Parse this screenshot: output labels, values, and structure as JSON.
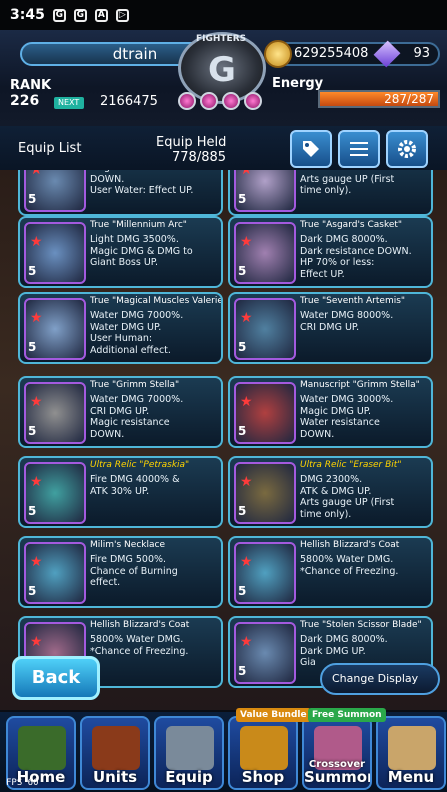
{
  "status_bar": {
    "time": "3:45",
    "icons": [
      "G",
      "G",
      "A",
      "▷"
    ]
  },
  "header": {
    "player_name": "dtrain",
    "coins": "629255408",
    "gems": "93",
    "logo_text": "FIGHTERS",
    "logo_letter": "G",
    "rank_label": "RANK",
    "rank_value": "226",
    "next_label": "NEXT",
    "exp_value": "2166475",
    "energy_label": "Energy",
    "energy_value": "287/287",
    "energy_fraction": 1.0
  },
  "subbar": {
    "equip_list_label": "Equip List",
    "equip_held_label": "Equip Held",
    "equip_held_value": "778/885"
  },
  "cards": [
    {
      "title": "",
      "relic": false,
      "desc": "Magic resistance\nDOWN.\nUser Water: Effect UP.",
      "level": "5"
    },
    {
      "title": "",
      "relic": false,
      "desc": "Dark DMG UP.\nArts gauge UP (First\ntime only).",
      "level": "5"
    },
    {
      "title": "True \"Millennium Arc\"",
      "relic": false,
      "desc": "Light DMG 3500%.\nMagic DMG & DMG to\nGiant Boss UP.",
      "level": "5"
    },
    {
      "title": "True \"Asgard's Casket\"",
      "relic": false,
      "desc": "Dark DMG 8000%.\nDark resistance DOWN.\nHP 70% or less:\nEffect UP.",
      "level": "5"
    },
    {
      "title": "True \"Magical Muscles Valerie\"",
      "relic": false,
      "desc": "Water DMG 7000%.\nWater DMG UP.\nUser Human:\nAdditional effect.",
      "level": "5"
    },
    {
      "title": "True \"Seventh Artemis\"",
      "relic": false,
      "desc": "Water DMG 8000%.\nCRI DMG UP.",
      "level": "5"
    },
    {
      "title": "True \"Grimm Stella\"",
      "relic": false,
      "desc": "Water DMG 7000%.\nCRI DMG UP.\nMagic resistance\nDOWN.",
      "level": "5"
    },
    {
      "title": "Manuscript \"Grimm Stella\"",
      "relic": false,
      "desc": "Water DMG 3000%.\nMagic DMG UP.\nWater resistance\nDOWN.",
      "level": "5"
    },
    {
      "title": "Ultra Relic \"Petraskia\"",
      "relic": true,
      "desc": "Fire DMG 4000% &\nATK 30% UP.",
      "level": "5"
    },
    {
      "title": "Ultra Relic \"Eraser Bit\"",
      "relic": true,
      "desc": "DMG 2300%.\nATK & DMG UP.\nArts gauge UP (First\ntime only).",
      "level": "5"
    },
    {
      "title": "Milim's Necklace",
      "relic": false,
      "desc": "Fire DMG 500%.\nChance of Burning\neffect.",
      "level": "5"
    },
    {
      "title": "Hellish Blizzard's Coat",
      "relic": false,
      "desc": "5800% Water DMG.\n*Chance of Freezing.",
      "level": "5"
    },
    {
      "title": "Hellish Blizzard's Coat",
      "relic": false,
      "desc": "5800% Water DMG.\n*Chance of Freezing.",
      "level": "5"
    },
    {
      "title": "True \"Stolen Scissor Blade\"",
      "relic": false,
      "desc": "Dark DMG 8000%.\nDark DMG UP.\nGia",
      "level": "5"
    }
  ],
  "buttons": {
    "back": "Back",
    "change_display": "Change Display"
  },
  "nav": [
    {
      "label": "Home"
    },
    {
      "label": "Units"
    },
    {
      "label": "Equip"
    },
    {
      "label": "Shop",
      "tag": "Value Bundle"
    },
    {
      "label": "Summon",
      "tag": "Free Summon",
      "sub": "Crossover"
    },
    {
      "label": "Menu"
    }
  ],
  "fps": "FPS 60"
}
